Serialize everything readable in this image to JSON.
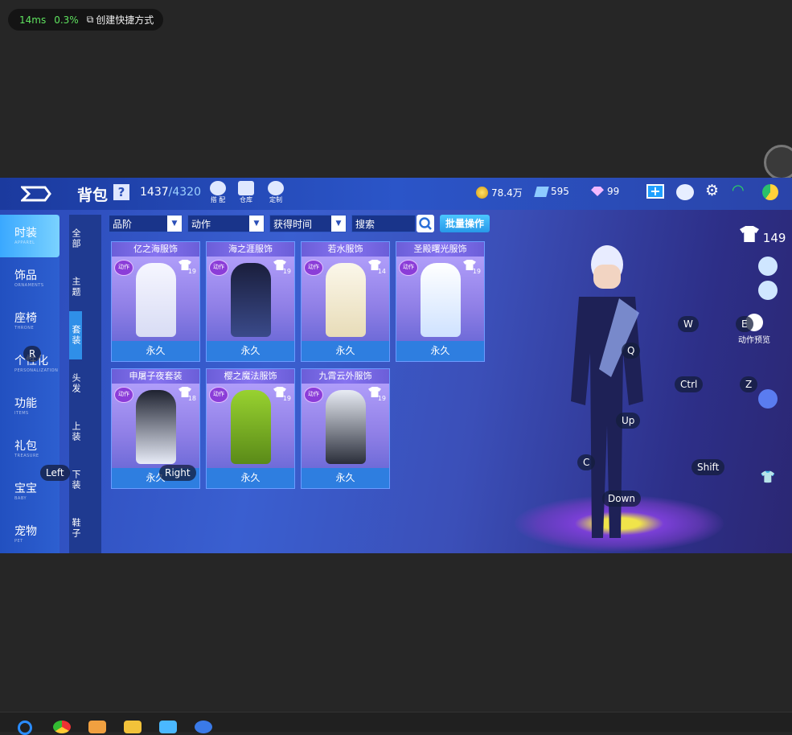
{
  "overlay": {
    "latency": "14ms",
    "load": "0.3%",
    "shortcut_label": "创建快捷方式"
  },
  "header": {
    "title": "背包",
    "help": "?",
    "capacity_used": "1437",
    "capacity_total": "/4320",
    "buttons": [
      {
        "label": "搭 配",
        "icon": "outfit-icon"
      },
      {
        "label": "仓库",
        "icon": "warehouse-icon"
      },
      {
        "label": "定制",
        "icon": "custom-icon"
      }
    ],
    "currency": {
      "coins": "78.4万",
      "tickets": "595",
      "diamonds": "99"
    }
  },
  "sidebar": [
    {
      "cn": "时装",
      "en": "APPAREL",
      "active": true
    },
    {
      "cn": "饰品",
      "en": "ORNAMENTS",
      "active": false
    },
    {
      "cn": "座椅",
      "en": "THRONE",
      "active": false
    },
    {
      "cn": "个性化",
      "en": "PERSONALIZATION",
      "active": false
    },
    {
      "cn": "功能",
      "en": "ITEMS",
      "active": false
    },
    {
      "cn": "礼包",
      "en": "TREASURE",
      "active": false
    },
    {
      "cn": "宝宝",
      "en": "BABY",
      "active": false
    },
    {
      "cn": "宠物",
      "en": "PET",
      "active": false
    }
  ],
  "subtabs": [
    {
      "label": "全部",
      "active": false
    },
    {
      "label": "主题",
      "active": false
    },
    {
      "label": "套装",
      "active": true
    },
    {
      "label": "头发",
      "active": false
    },
    {
      "label": "上装",
      "active": false
    },
    {
      "label": "下装",
      "active": false
    },
    {
      "label": "鞋子",
      "active": false
    }
  ],
  "filters": {
    "rank": "品阶",
    "action": "动作",
    "time": "获得时间",
    "search": "搜索",
    "batch": "批量操作"
  },
  "items": [
    {
      "name": "亿之海服饰",
      "badge": "动作",
      "count": "19",
      "duration": "永久",
      "colors": [
        "#f6f6ff",
        "#d8dcf4"
      ]
    },
    {
      "name": "海之涯服饰",
      "badge": "动作",
      "count": "19",
      "duration": "永久",
      "colors": [
        "#1a1e3c",
        "#3a4a8a"
      ]
    },
    {
      "name": "若水服饰",
      "badge": "动作",
      "count": "14",
      "duration": "永久",
      "colors": [
        "#fbf7ea",
        "#e8dcb8"
      ]
    },
    {
      "name": "圣殿曙光服饰",
      "badge": "动作",
      "count": "19",
      "duration": "永久",
      "colors": [
        "#ffffff",
        "#cfe2ff"
      ]
    },
    {
      "name": "申屠子夜套装",
      "badge": "动作",
      "count": "18",
      "duration": "永久",
      "colors": [
        "#1e2230",
        "#e8ecf8"
      ]
    },
    {
      "name": "樱之魔法服饰",
      "badge": "动作",
      "count": "19",
      "duration": "永久",
      "colors": [
        "#98d230",
        "#5a8a18"
      ]
    },
    {
      "name": "九霄云外服饰",
      "badge": "动作",
      "count": "19",
      "duration": "永久",
      "colors": [
        "#e8ecf4",
        "#2a2e3a"
      ]
    }
  ],
  "right_panel": {
    "outfit_count": "149",
    "preview_label": "动作预览"
  },
  "keys": [
    "R",
    "Left",
    "Right",
    "W",
    "E",
    "Q",
    "Ctrl",
    "Z",
    "Up",
    "C",
    "Shift",
    "Down"
  ]
}
